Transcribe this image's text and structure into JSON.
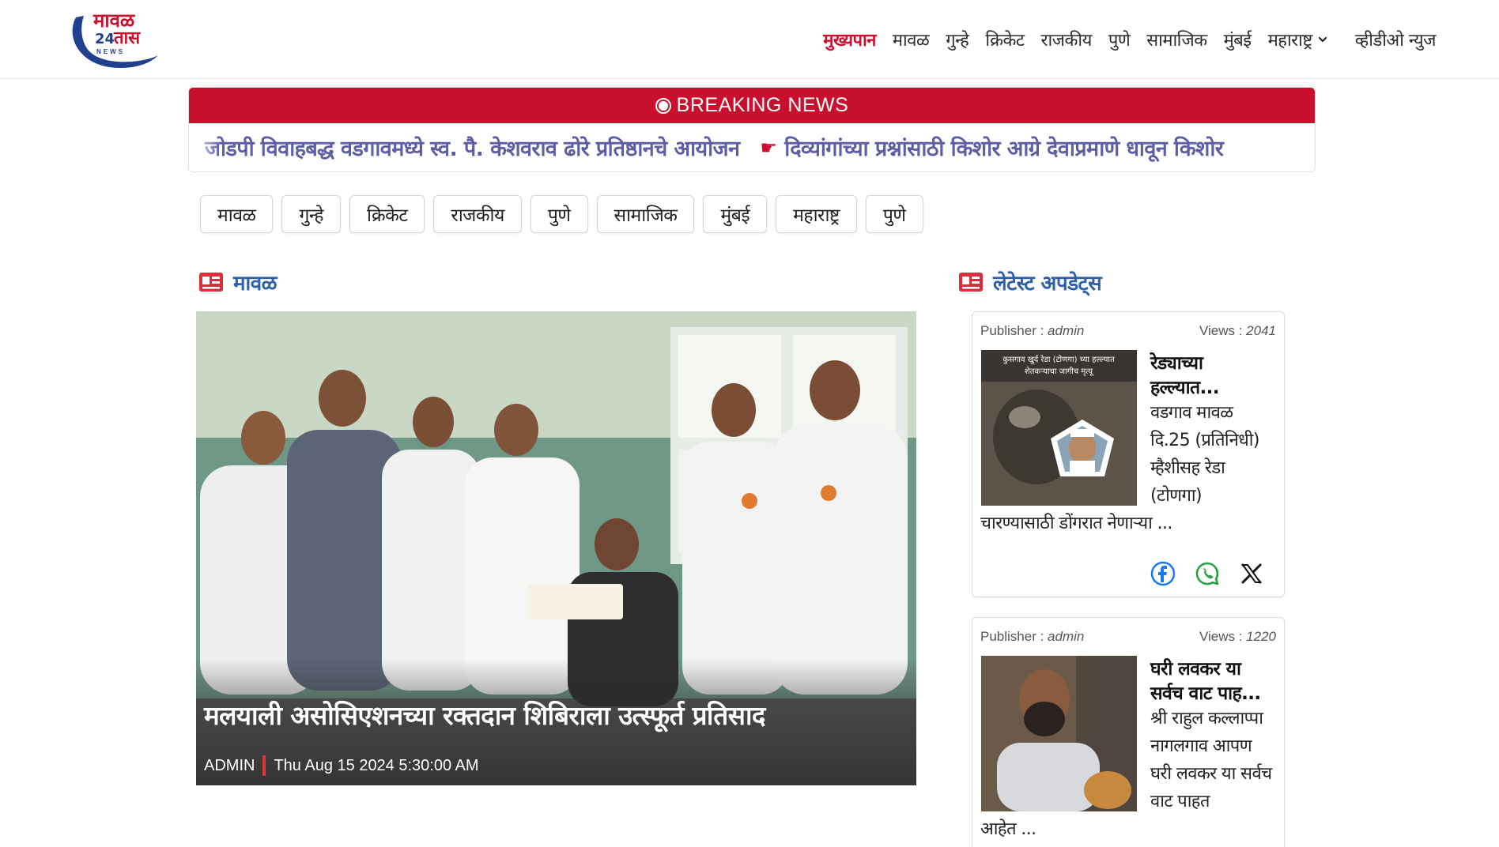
{
  "header": {
    "logo": {
      "word": "मावळ",
      "number": "24",
      "word2": "तास",
      "tag": "NEWS"
    },
    "nav": [
      {
        "label": "मुख्यपान",
        "active": true
      },
      {
        "label": "मावळ"
      },
      {
        "label": "गुन्हे"
      },
      {
        "label": "क्रिकेट"
      },
      {
        "label": "राजकीय"
      },
      {
        "label": "पुणे"
      },
      {
        "label": "सामाजिक"
      },
      {
        "label": "मुंबई"
      },
      {
        "label": "महाराष्ट्र",
        "dropdown": true
      },
      {
        "label": "व्हीडीओ न्युज"
      }
    ]
  },
  "breaking": {
    "title": "BREAKING NEWS",
    "items": [
      "जोडपी विवाहबद्ध वडगावमध्ये स्व. पै. केशवराव ढोरे प्रतिष्ठानचे आयोजन",
      "दिव्यांगांच्या प्रश्नांसाठी किशोर आग्रे देवाप्रमाणे धावून किशोर"
    ]
  },
  "chips": [
    "मावळ",
    "गुन्हे",
    "क्रिकेट",
    "राजकीय",
    "पुणे",
    "सामाजिक",
    "मुंबई",
    "महाराष्ट्र",
    "पुणे"
  ],
  "left_section": {
    "title": "मावळ"
  },
  "featured": {
    "title": "मलयाली असोसिएशनच्या रक्तदान शिबिराला उत्स्फूर्त प्रतिसाद",
    "author": "ADMIN",
    "date": "Thu Aug 15 2024 5:30:00 AM"
  },
  "right_section": {
    "title": "लेटेस्ट अपडेट्स"
  },
  "cards": [
    {
      "publisher_label": "Publisher : ",
      "publisher": "admin",
      "views_label": "Views : ",
      "views": "2041",
      "thumb_caption_1": "कुसगाव खुर्द रेडा (टोणगा) च्या हल्ल्यात",
      "thumb_caption_2": "शेतकऱ्याचा जागीच मृत्यू",
      "title": "रेड्याच्या हल्ल्यात...",
      "body": "वडगाव मावळ दि.25 (प्रतिनिधी) म्हैशीसह रेडा (टोणगा)",
      "body_tail": "चारण्यासाठी डोंगरात नेणाऱ्या ..."
    },
    {
      "publisher_label": "Publisher : ",
      "publisher": "admin",
      "views_label": "Views : ",
      "views": "1220",
      "title": "घरी लवकर या सर्वच वाट पाह...",
      "body": "श्री राहुल कल्लाप्पा नागलगाव आपण घरी लवकर या सर्वच वाट पाहत",
      "body_tail": "आहेत ..."
    }
  ],
  "colors": {
    "brand_red": "#c8102e",
    "link_blue": "#2e5fa7",
    "ticker_text": "#5d5ea3"
  }
}
